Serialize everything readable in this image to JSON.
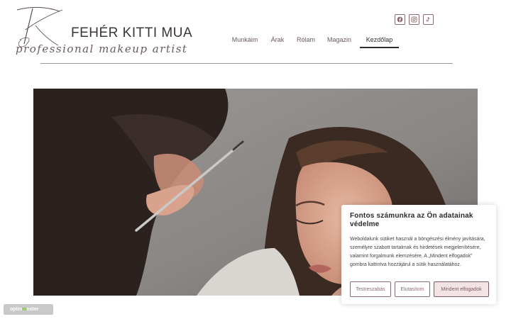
{
  "brand": {
    "name": "FEHÉR KITTI MUA",
    "tagline": "professional makeup artist"
  },
  "socials": [
    {
      "icon": "facebook-icon"
    },
    {
      "icon": "instagram-icon"
    },
    {
      "icon": "tiktok-icon"
    }
  ],
  "nav": {
    "items": [
      {
        "label": "Munkáim"
      },
      {
        "label": "Árak"
      },
      {
        "label": "Rólam"
      },
      {
        "label": "Magazin"
      },
      {
        "label": "Kezdőlap",
        "active": true
      }
    ]
  },
  "cookie": {
    "title": "Fontos számunkra az Ön adatainak védelme",
    "text": "Weboldalunk sütiket használ a böngészési élmény javítására, személyre szabott tartalmak és hirdetések megjelenítésére, valamint forgalmunk elemzésére. A „Mindent elfogadok” gombra kattintva hozzájárul a sütik használatához.",
    "customize_label": "Testreszabás",
    "reject_label": "Elutasítom",
    "accept_label": "Mindent elfogadok"
  },
  "badge": {
    "prefix": "optin",
    "o": "m",
    "suffix": "nster"
  },
  "colors": {
    "accent": "#8b6b70",
    "accent_fill": "#f2e3e5"
  }
}
